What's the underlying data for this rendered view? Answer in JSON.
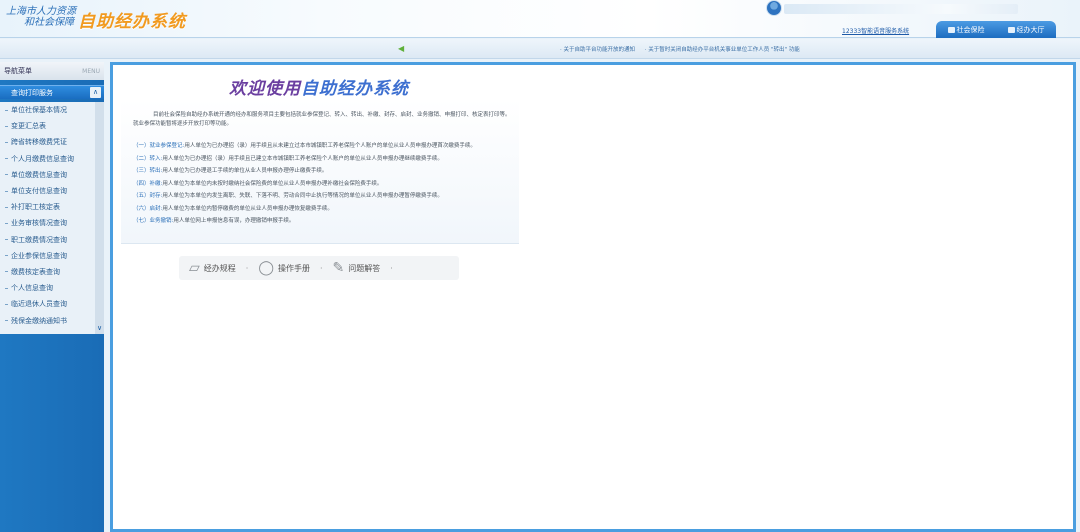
{
  "header": {
    "org_line1": "上海市人力资源",
    "org_line2": "和社会保障",
    "system_title": "自助经办系统",
    "hotline_link": "12333智能语音服务系统",
    "tabs": [
      {
        "label": "社会保险",
        "icon": "monitor-icon"
      },
      {
        "label": "经办大厅",
        "icon": "building-icon"
      }
    ]
  },
  "notices": [
    "· 关于自助平台功能开放的通知",
    "· 关于暂时关闭自助经办平台机关事业单位工作人员 \"转出\" 功能"
  ],
  "sidebar": {
    "title": "导航菜单",
    "menu_label": "MENU",
    "section": "查询打印服务",
    "items": [
      "单位社保基本情况",
      "变更汇总表",
      "跨省转移缴费凭证",
      "个人月缴费信息查询",
      "单位缴费信息查询",
      "单位支付信息查询",
      "补打职工核定表",
      "业务审核情况查询",
      "职工缴费情况查询",
      "企业参保信息查询",
      "缴费核定表查询",
      "个人信息查询",
      "临近退休人员查询",
      "残保金缴纳通知书"
    ]
  },
  "main": {
    "welcome_prefix": "欢迎使用",
    "welcome_system": "自助经办系统",
    "intro": "目前社会保险自助经办系统开通的经办和服务项目主要包括就业参保登记、转入、转出、补缴、封存、启封、业务撤销、申报打印、核定表打印等。就业参保功能暂将逐步开放打印等功能。",
    "items": [
      {
        "key": "（一）就业参保登记:",
        "text": "用人单位为已办理招（录）用手续且从未建立过本市城镇职工养老保险个人账户的单位从业人员申报办理首次缴费手续。"
      },
      {
        "key": "（二）转入:",
        "text": "用人单位为已办理招（录）用手续且已建立本市城镇职工养老保险个人账户的单位从业人员申报办理继续缴费手续。"
      },
      {
        "key": "（三）转出:",
        "text": "用人单位为已办理退工手续的单位从业人员申报办理停止缴费手续。"
      },
      {
        "key": "（四）补缴:",
        "text": "用人单位为本单位内未按时缴纳社会保险费的单位从业人员申报办理补缴社会保险费手续。"
      },
      {
        "key": "（五）封存:",
        "text": "用人单位为本单位内发生离职、失联、下落不明、劳动合同中止执行等情况的单位从业人员申报办理暂停缴费手续。"
      },
      {
        "key": "（六）启封:",
        "text": "用人单位为本单位内暂停缴费的单位从业人员申报办理恢复缴费手续。"
      },
      {
        "key": "（七）业务撤销:",
        "text": "用人单位网上申报信息有误，办理撤销申报手续。"
      }
    ],
    "buttons": [
      {
        "label": "经办规程",
        "icon": "document-icon"
      },
      {
        "label": "操作手册",
        "icon": "mouse-icon"
      },
      {
        "label": "问题解答",
        "icon": "notepad-icon"
      }
    ]
  }
}
